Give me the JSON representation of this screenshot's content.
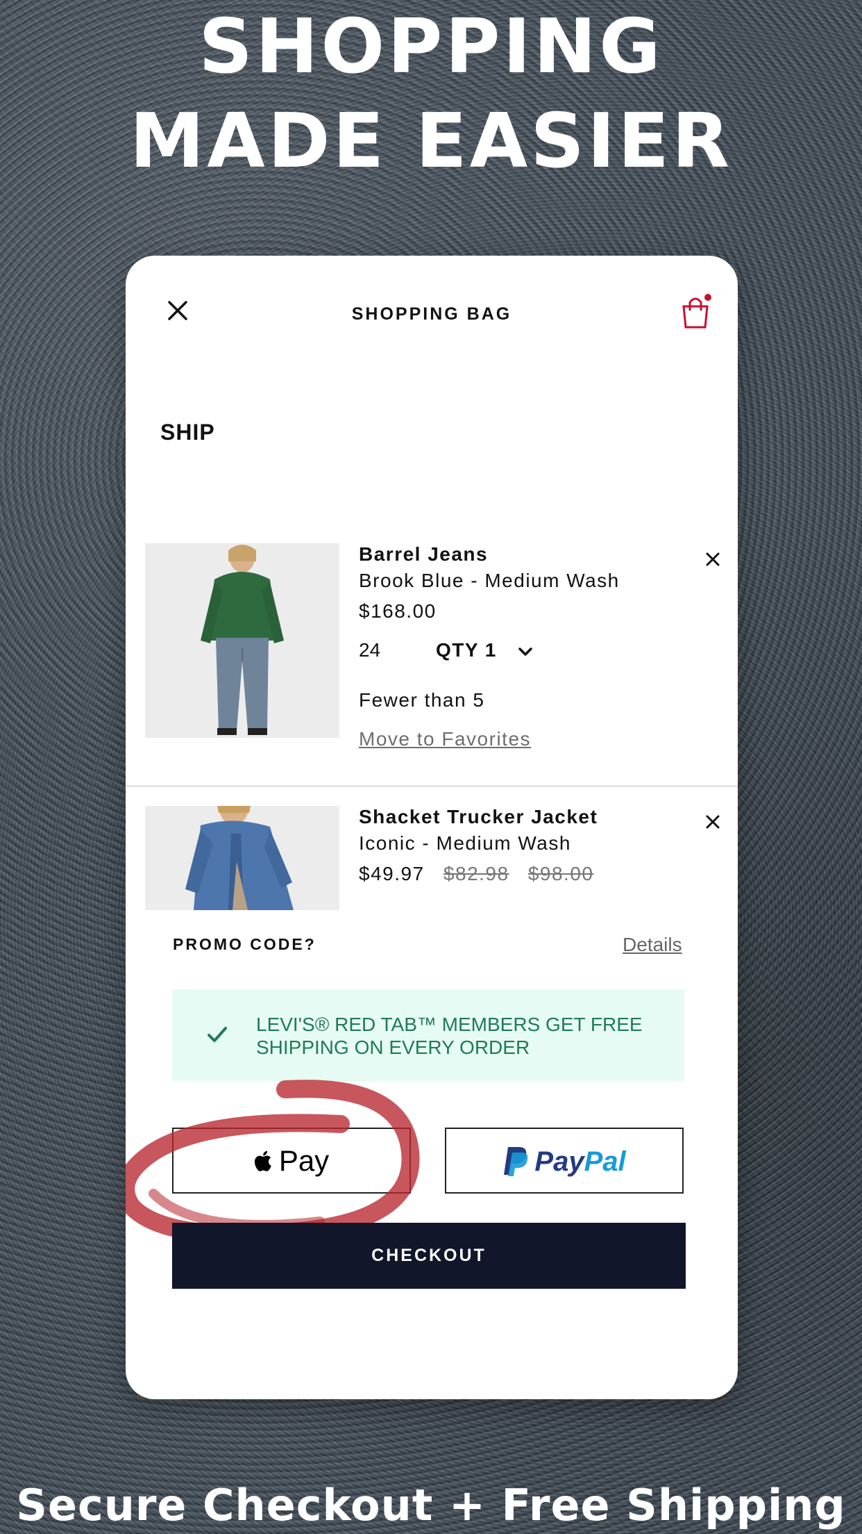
{
  "promo_banner": {
    "headline_line1": "SHOPPING",
    "headline_line2": "MADE EASIER",
    "tagline": "Secure Checkout + Free Shipping"
  },
  "header": {
    "title": "SHOPPING BAG",
    "close_icon": "close-icon",
    "bag_icon": "shopping-bag-icon",
    "bag_badge_color": "#c41230"
  },
  "section": {
    "label": "SHIP"
  },
  "items": [
    {
      "name": "Barrel Jeans",
      "variant": "Brook Blue - Medium Wash",
      "price": "$168.00",
      "size": "24",
      "qty_label": "QTY 1",
      "stock": "Fewer than 5",
      "move_to_favorites": "Move to Favorites"
    },
    {
      "name": "Shacket Trucker Jacket",
      "variant": "Iconic - Medium Wash",
      "price": "$49.97",
      "original_price_1": "$82.98",
      "original_price_2": "$98.00"
    }
  ],
  "promo": {
    "label": "PROMO CODE?",
    "details_link": "Details"
  },
  "banner": {
    "text": "LEVI'S® RED TAB™ MEMBERS GET FREE SHIPPING ON EVERY ORDER",
    "icon": "check-icon",
    "bg_color": "#e6fbf3",
    "text_color": "#1f7a5a"
  },
  "payment": {
    "apple_pay_label": "Pay",
    "paypal_pay": "Pay",
    "paypal_pal": "Pal"
  },
  "checkout": {
    "label": "CHECKOUT",
    "bg_color": "#12162a"
  }
}
